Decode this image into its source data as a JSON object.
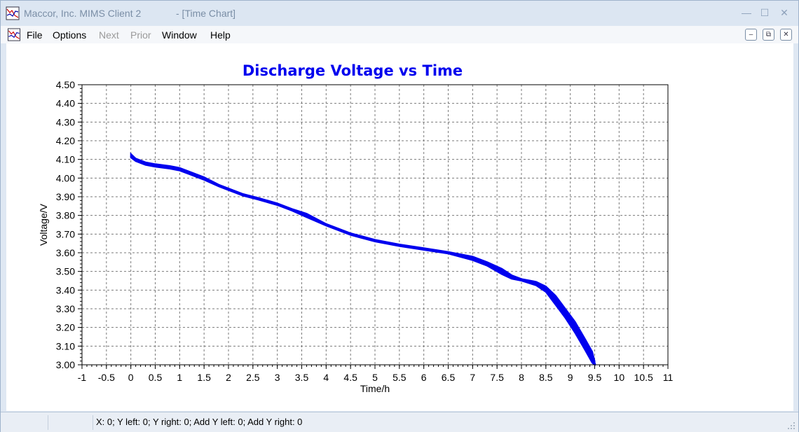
{
  "window": {
    "app_title": "Maccor, Inc. MIMS Client 2",
    "doc_title": "- [Time Chart]"
  },
  "menu": {
    "items": [
      {
        "label": "File",
        "enabled": true
      },
      {
        "label": "Options",
        "enabled": true
      },
      {
        "label": "Next",
        "enabled": false
      },
      {
        "label": "Prior",
        "enabled": false
      },
      {
        "label": "Window",
        "enabled": true
      },
      {
        "label": "Help",
        "enabled": true
      }
    ]
  },
  "status": {
    "text": "X: 0; Y left: 0; Y right: 0; Add Y left: 0; Add Y right: 0"
  },
  "chart_data": {
    "type": "line",
    "title": "Discharge Voltage vs Time",
    "xlabel": "Time/h",
    "ylabel": "Voltage/V",
    "xlim": [
      -1,
      11
    ],
    "ylim": [
      3.0,
      4.5
    ],
    "x_ticks": [
      "-1",
      "-0.5",
      "0",
      "0.5",
      "1",
      "1.5",
      "2",
      "2.5",
      "3",
      "3.5",
      "4",
      "4.5",
      "5",
      "5.5",
      "6",
      "6.5",
      "7",
      "7.5",
      "8",
      "8.5",
      "9",
      "9.5",
      "10",
      "10.5",
      "11"
    ],
    "y_ticks": [
      "3.00",
      "3.10",
      "3.20",
      "3.30",
      "3.40",
      "3.50",
      "3.60",
      "3.70",
      "3.80",
      "3.90",
      "4.00",
      "4.10",
      "4.20",
      "4.30",
      "4.40",
      "4.50"
    ],
    "grid": true,
    "series_color": "#0000ee",
    "title_color": "#0000ee",
    "series": [
      {
        "x": [
          0,
          0.1,
          0.3,
          0.5,
          0.8,
          1.0,
          1.2,
          1.5,
          1.8,
          2.0,
          2.3,
          2.6,
          3.0,
          3.3,
          3.6,
          4.0,
          4.5,
          5.0,
          5.5,
          6.0,
          6.5,
          7.0,
          7.3,
          7.6,
          7.8,
          8.0,
          8.3,
          8.5,
          8.7,
          8.9,
          9.1,
          9.3,
          9.45,
          9.5
        ],
        "y": [
          4.12,
          4.1,
          4.08,
          4.07,
          4.06,
          4.05,
          4.03,
          4.0,
          3.96,
          3.94,
          3.91,
          3.89,
          3.86,
          3.83,
          3.8,
          3.75,
          3.7,
          3.665,
          3.64,
          3.62,
          3.6,
          3.57,
          3.54,
          3.5,
          3.47,
          3.455,
          3.435,
          3.41,
          3.35,
          3.28,
          3.2,
          3.11,
          3.04,
          3.0
        ],
        "y_min": [
          4.11,
          4.09,
          4.07,
          4.06,
          4.05,
          4.04,
          4.02,
          3.99,
          3.955,
          3.935,
          3.905,
          3.885,
          3.855,
          3.825,
          3.79,
          3.745,
          3.695,
          3.66,
          3.635,
          3.615,
          3.595,
          3.56,
          3.53,
          3.485,
          3.46,
          3.45,
          3.425,
          3.39,
          3.32,
          3.25,
          3.17,
          3.08,
          3.01,
          3.0
        ],
        "y_max": [
          4.13,
          4.105,
          4.085,
          4.075,
          4.065,
          4.055,
          4.035,
          4.005,
          3.965,
          3.945,
          3.915,
          3.895,
          3.865,
          3.835,
          3.81,
          3.755,
          3.705,
          3.67,
          3.645,
          3.625,
          3.605,
          3.58,
          3.55,
          3.515,
          3.48,
          3.46,
          3.445,
          3.42,
          3.37,
          3.3,
          3.23,
          3.14,
          3.07,
          3.02
        ]
      }
    ]
  }
}
